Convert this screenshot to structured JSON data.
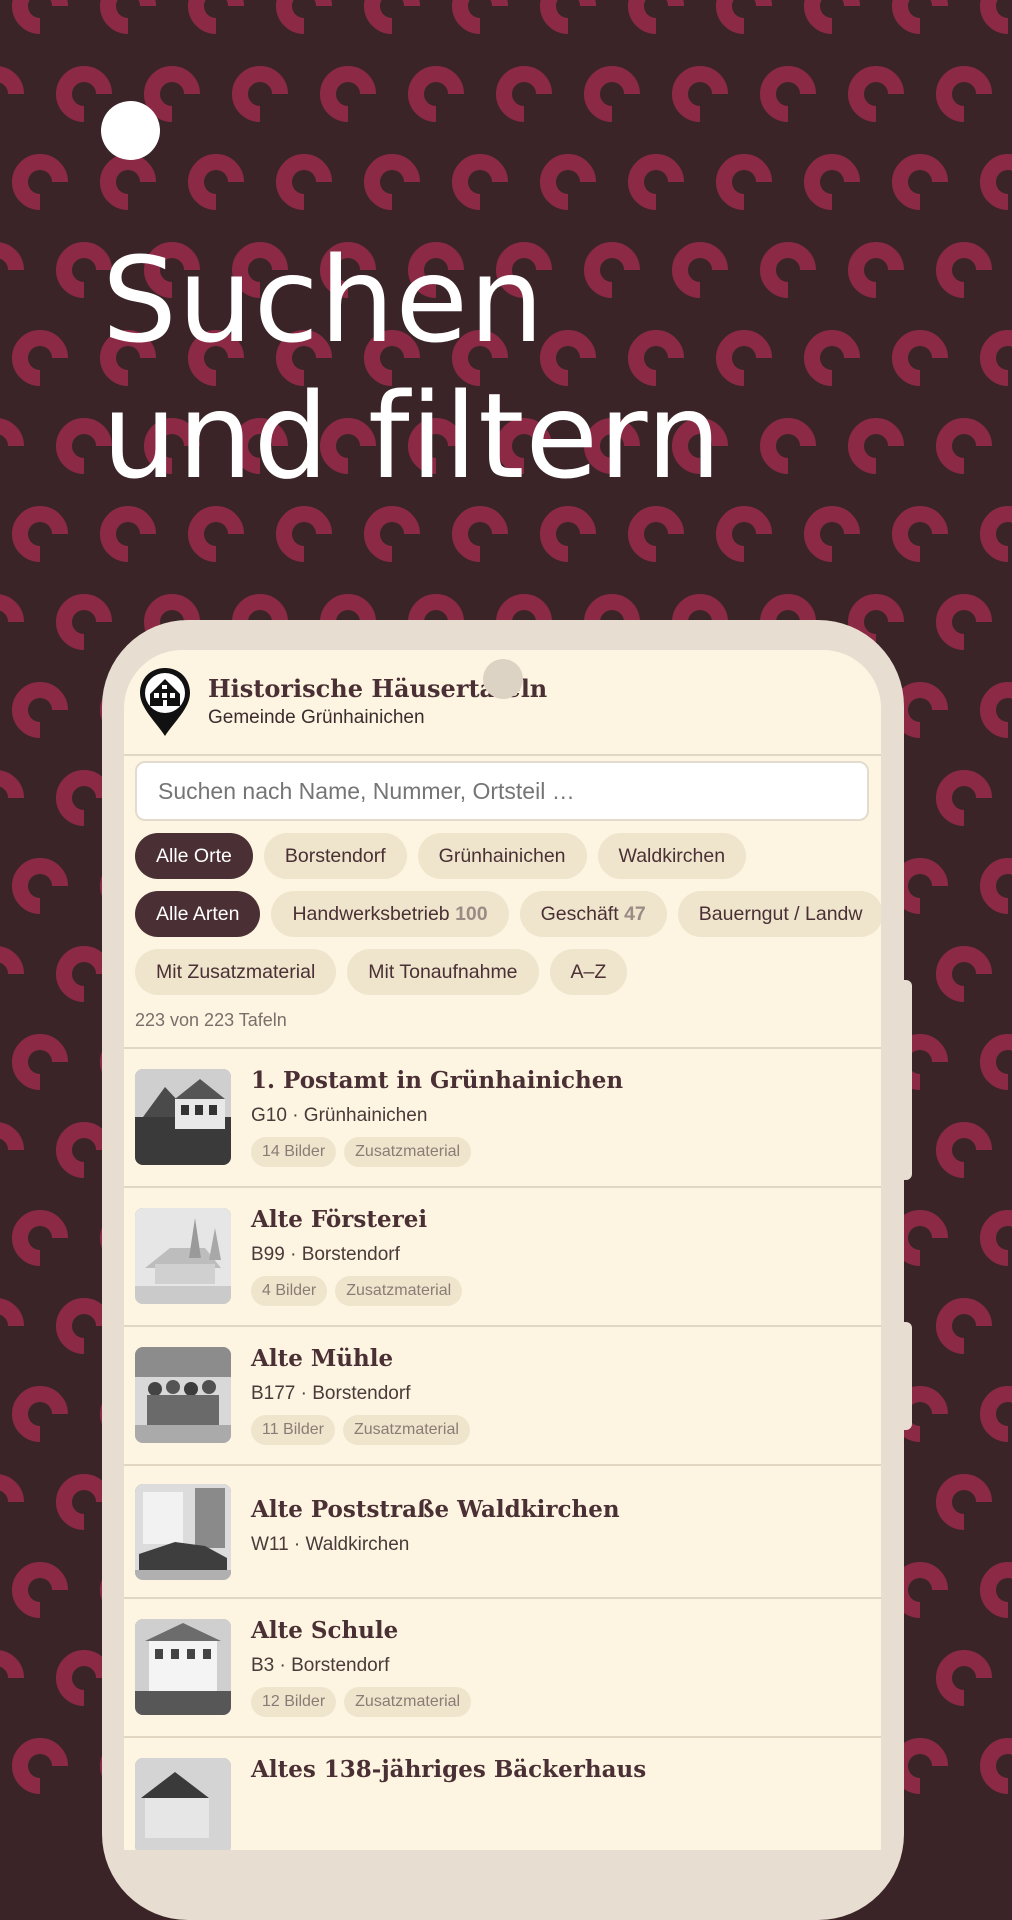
{
  "hero": {
    "line1": "Suchen",
    "line2": "und filtern"
  },
  "colors": {
    "background": "#3a2427",
    "pattern": "#8c2a46",
    "accent": "#4a3035",
    "screen": "#fdf5e1",
    "chip": "#efe5cd"
  },
  "app": {
    "title": "Historische Häusertafeln",
    "subtitle": "Gemeinde Grünhainichen",
    "logo_icon": "map-pin-house-icon"
  },
  "search": {
    "placeholder": "Suchen nach Name, Nummer, Ortsteil …"
  },
  "filters": {
    "places": [
      {
        "label": "Alle Orte",
        "active": true
      },
      {
        "label": "Borstendorf",
        "active": false
      },
      {
        "label": "Grünhainichen",
        "active": false
      },
      {
        "label": "Waldkirchen",
        "active": false
      }
    ],
    "types": [
      {
        "label": "Alle Arten",
        "count": "",
        "active": true
      },
      {
        "label": "Handwerksbetrieb",
        "count": "100",
        "active": false
      },
      {
        "label": "Geschäft",
        "count": "47",
        "active": false
      },
      {
        "label": "Bauerngut / Landw",
        "count": "",
        "active": false
      }
    ],
    "options": [
      {
        "label": "Mit Zusatzmaterial"
      },
      {
        "label": "Mit Tonaufnahme"
      },
      {
        "label": "A–Z"
      }
    ]
  },
  "result_count": "223 von 223 Tafeln",
  "items": [
    {
      "title": "1. Postamt in Grünhainichen",
      "meta": "G10 · Grünhainichen",
      "tags": [
        "14 Bilder",
        "Zusatzmaterial"
      ]
    },
    {
      "title": "Alte Försterei",
      "meta": "B99 · Borstendorf",
      "tags": [
        "4 Bilder",
        "Zusatzmaterial"
      ]
    },
    {
      "title": "Alte Mühle",
      "meta": "B177 · Borstendorf",
      "tags": [
        "11 Bilder",
        "Zusatzmaterial"
      ]
    },
    {
      "title": "Alte Poststraße Waldkirchen",
      "meta": "W11 · Waldkirchen",
      "tags": []
    },
    {
      "title": "Alte Schule",
      "meta": "B3 · Borstendorf",
      "tags": [
        "12 Bilder",
        "Zusatzmaterial"
      ]
    },
    {
      "title": "Altes 138-jähriges Bäckerhaus",
      "meta": "",
      "tags": []
    }
  ]
}
